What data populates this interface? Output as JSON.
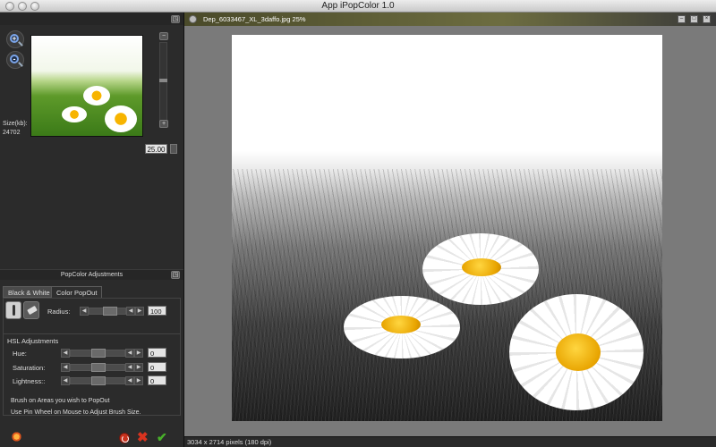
{
  "window": {
    "title": "App iPopColor 1.0"
  },
  "preview": {
    "size_label": "Size(kb):",
    "size_value": "24702",
    "zoom_value": "25.00",
    "zoom_minus": "−",
    "zoom_plus": "+"
  },
  "popcolor": {
    "title": "PopColor Adjustments",
    "tabs": [
      "Black & White",
      "Color PopOut"
    ],
    "active_tab": "Color PopOut",
    "radius_label": "Radius:",
    "radius_value": "100",
    "hsl_title": "HSL Adjustments",
    "hue_label": "Hue:",
    "hue_value": "0",
    "saturation_label": "Saturation:",
    "saturation_value": "0",
    "lightness_label": "Lightness::",
    "lightness_value": "0",
    "hint1": "Brush on Areas you wish to PopOut",
    "hint2": "Use Pin Wheel on Mouse to Adjust Brush Size."
  },
  "document": {
    "title": "Dep_6033467_XL_3daffo.jpg 25%",
    "status": "3034 x 2714 pixels (180 dpi)",
    "minimize": "–",
    "restore": "□",
    "close": "×"
  },
  "colors": {
    "accent_doc_tab": "#6d6d40",
    "ok": "#48b02a",
    "cancel": "#d9331f"
  }
}
